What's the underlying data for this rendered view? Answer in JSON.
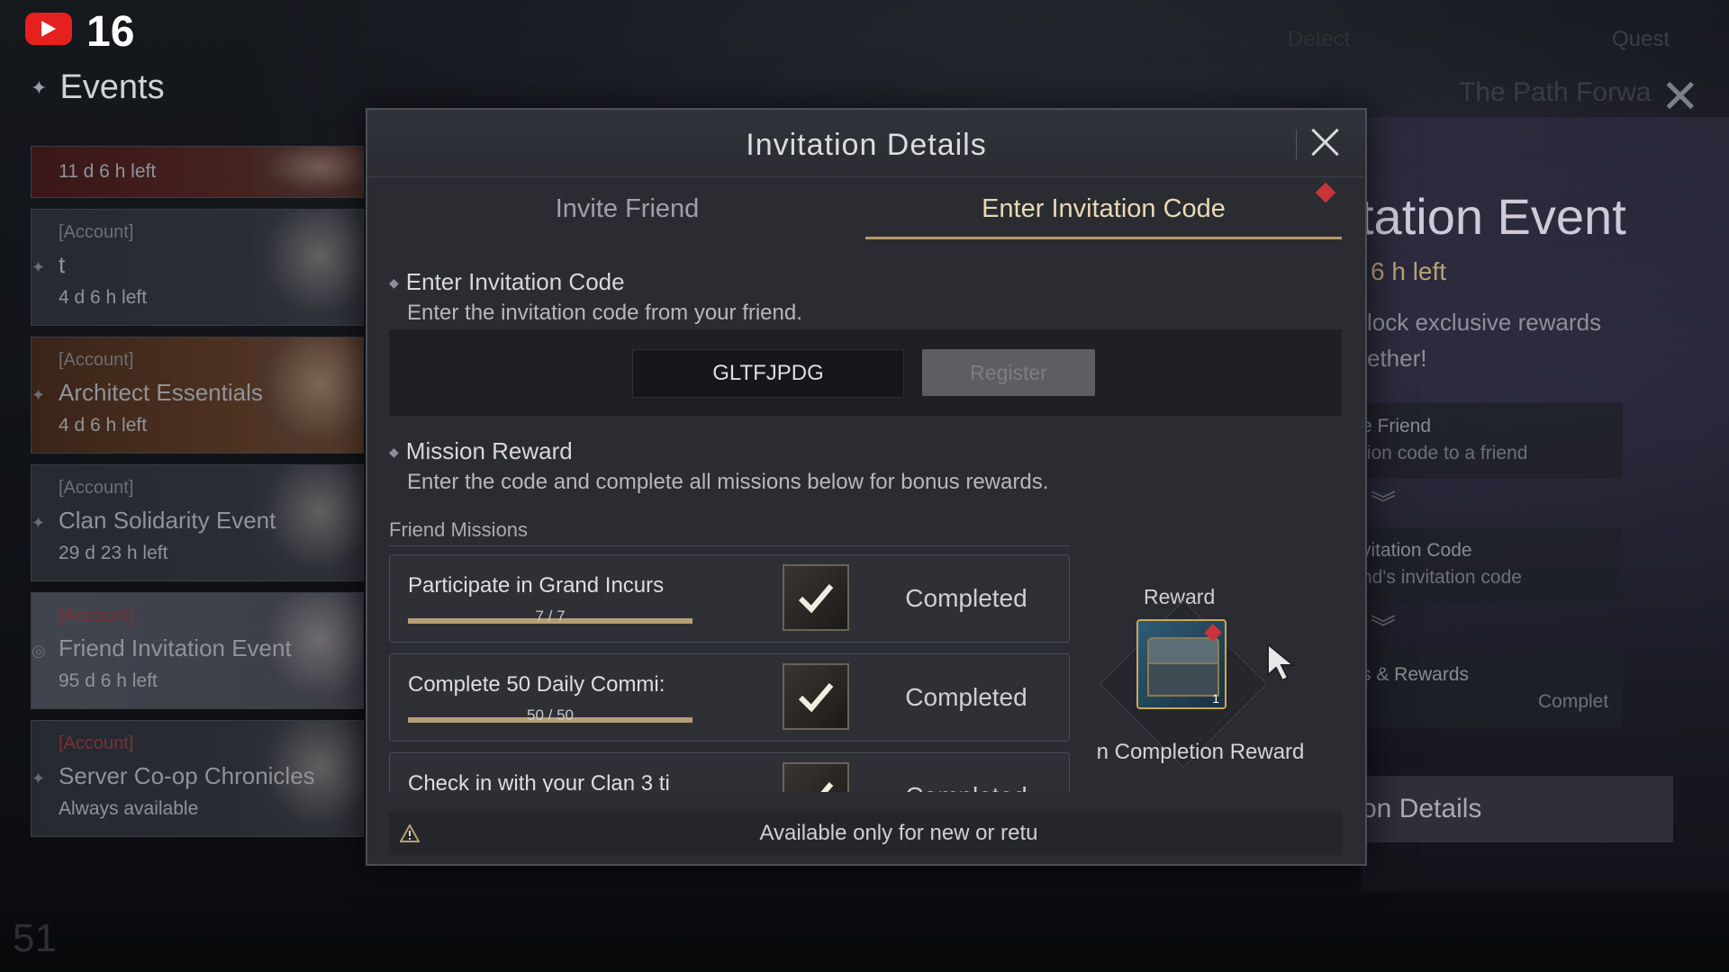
{
  "hud": {
    "count": "16",
    "quest": "Quest",
    "hud_mid": "Detect"
  },
  "events": {
    "title": "Events",
    "items": [
      {
        "tag": "",
        "name": "",
        "time": "11 d 6 h left"
      },
      {
        "tag": "[Account]",
        "name": "t",
        "time": "4 d 6 h left"
      },
      {
        "tag": "[Account]",
        "name": "Architect Essentials",
        "time": "4 d 6 h left"
      },
      {
        "tag": "[Account]",
        "name": "Clan Solidarity Event",
        "time": "29 d 23 h left"
      },
      {
        "tag": "[Account]",
        "name": "Friend Invitation Event",
        "time": "95 d 6 h left"
      },
      {
        "tag": "[Account]",
        "name": "Server Co-op Chronicles",
        "time": "Always available"
      }
    ]
  },
  "level": "51",
  "right_panel": {
    "path_title": "The Path Forwa",
    "title": "tation Event",
    "time": "6 h left",
    "desc_line1": "lock exclusive rewards",
    "desc_line2": "ether!",
    "box1_t1": "e Friend",
    "box1_t2": "tion code to a friend",
    "box2_t1": "vitation Code",
    "box2_t2": "nd's invitation code",
    "box3_t1": "s & Rewards",
    "box3_t2": "Complet",
    "button": "on Details"
  },
  "modal": {
    "title": "Invitation Details",
    "tabs": [
      {
        "label": "Invite Friend"
      },
      {
        "label": "Enter Invitation Code"
      }
    ],
    "enter_section": {
      "heading": "Enter Invitation Code",
      "desc": "Enter the invitation code from your friend.",
      "code_value": "GLTFJPDG",
      "register_label": "Register"
    },
    "mission_section": {
      "heading": "Mission Reward",
      "desc": "Enter the code and complete all missions below for bonus rewards.",
      "friend_missions_label": "Friend Missions"
    },
    "missions": [
      {
        "name": "Participate in Grand Incurs",
        "progress_text": "7 / 7",
        "progress": 1.0,
        "status": "Completed"
      },
      {
        "name": "Complete 50 Daily Commi:",
        "progress_text": "50 / 50",
        "progress": 1.0,
        "status": "Completed"
      },
      {
        "name": "Check in with your Clan 3 ti",
        "progress_text": "",
        "progress": 1.0,
        "status": "Completed"
      }
    ],
    "reward": {
      "label": "Reward",
      "quantity": "1",
      "caption": "n Completion Reward"
    },
    "footer_text": "Available only for new or retu"
  },
  "colors": {
    "accent_gold": "#b69a68",
    "notify_red": "#c8343c",
    "youtube_red": "#e5211f"
  }
}
